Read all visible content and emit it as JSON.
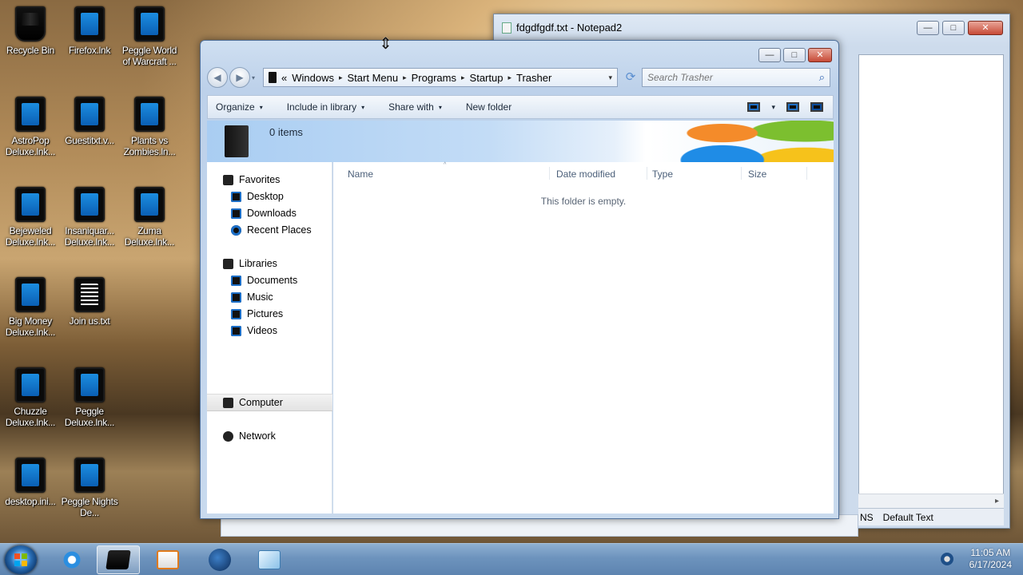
{
  "desktop": {
    "icons": [
      {
        "label": "Recycle Bin"
      },
      {
        "label": "Firefox.lnk"
      },
      {
        "label": "Peggle World of Warcraft ..."
      },
      {
        "label": "AstroPop Deluxe.lnk..."
      },
      {
        "label": "Guestitxt.v..."
      },
      {
        "label": "Plants vs Zombies.ln..."
      },
      {
        "label": "Bejeweled Deluxe.lnk..."
      },
      {
        "label": "Insaniquar... Deluxe.lnk..."
      },
      {
        "label": "Zuma Deluxe.lnk..."
      },
      {
        "label": "Big Money Deluxe.lnk..."
      },
      {
        "label": "Join us.txt"
      },
      {
        "label": "Chuzzle Deluxe.lnk..."
      },
      {
        "label": "Peggle Deluxe.lnk..."
      },
      {
        "label": "desktop.ini..."
      },
      {
        "label": "Peggle Nights De..."
      }
    ]
  },
  "notepad": {
    "title": "fdgdfgdf.txt - Notepad2",
    "status_mode": "NS",
    "status_scheme": "Default Text",
    "scroll_right": "▸"
  },
  "explorer": {
    "window_buttons": {
      "minimize": "—",
      "maximize": "□",
      "close": "✕"
    },
    "nav": {
      "back": "◀",
      "forward": "▶",
      "dropdown": "▾"
    },
    "breadcrumb": {
      "prefix": "«",
      "separator": "▸",
      "items": [
        "Windows",
        "Start Menu",
        "Programs",
        "Startup",
        "Trasher"
      ]
    },
    "address_dropdown": "▾",
    "refresh": "⟳",
    "search": {
      "placeholder": "Search Trasher",
      "icon": "⌕"
    },
    "commands": [
      {
        "label": "Organize",
        "has_menu": true
      },
      {
        "label": "Include in library",
        "has_menu": true
      },
      {
        "label": "Share with",
        "has_menu": true
      },
      {
        "label": "New folder",
        "has_menu": false
      }
    ],
    "menu_arrow": "▾",
    "details": {
      "count": "0 items"
    },
    "navpane": {
      "favorites": "Favorites",
      "desktop": "Desktop",
      "downloads": "Downloads",
      "recent_places": "Recent Places",
      "libraries": "Libraries",
      "documents": "Documents",
      "music": "Music",
      "pictures": "Pictures",
      "videos": "Videos",
      "computer": "Computer",
      "network": "Network"
    },
    "columns": [
      "Name",
      "Date modified",
      "Type",
      "Size"
    ],
    "sort_indicator": "^",
    "empty_message": "This folder is empty."
  },
  "taskbar": {
    "clock_time": "11:05 AM",
    "clock_date": "6/17/2024"
  },
  "cursor": "⇕"
}
